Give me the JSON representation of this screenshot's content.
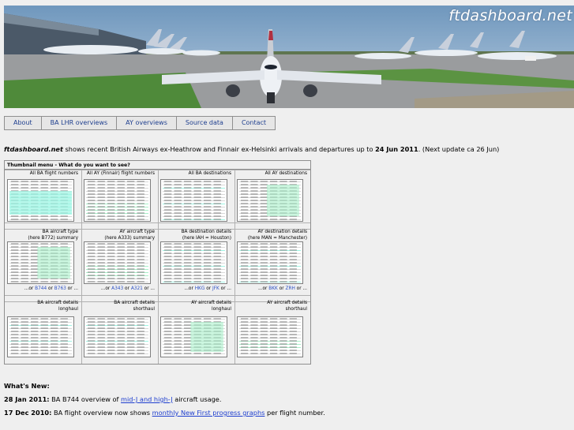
{
  "site": {
    "title": "ftdashboard.net"
  },
  "nav": {
    "items": [
      "About",
      "BA LHR overviews",
      "AY overviews",
      "Source data",
      "Contact"
    ]
  },
  "intro": {
    "brand": "ftdashboard.net",
    "text": " shows recent British Airways ex-Heathrow and Finnair ex-Helsinki arrivals and departures up to ",
    "date": "24 Jun 2011",
    "after": ". (Next update ca 26 Jun)"
  },
  "menu": {
    "header": "Thumbnail menu - What do you want to see?",
    "row1": [
      "All BA flight numbers",
      "All AY (Finnair) flight numbers",
      "All BA destinations",
      "All AY destinations"
    ],
    "row2": [
      [
        "BA aircraft type",
        "(here B772) summary"
      ],
      [
        "AY aircraft type",
        "(here A333) summary"
      ],
      [
        "BA destination details",
        "(here IAH = Houston)"
      ],
      [
        "AY destination details",
        "(here MAN = Manchester)"
      ]
    ],
    "row2_links": [
      {
        "prefix": "...or ",
        "a": "B744",
        "mid": " or ",
        "b": "B763",
        "suffix": " or ..."
      },
      {
        "prefix": "...or ",
        "a": "A343",
        "mid": " or ",
        "b": "A321",
        "suffix": " or ..."
      },
      {
        "prefix": "...or ",
        "a": "HKG",
        "mid": " or ",
        "b": "JFK",
        "suffix": " or ..."
      },
      {
        "prefix": "...or ",
        "a": "BKK",
        "mid": " or ",
        "b": "ZRH",
        "suffix": " or ..."
      }
    ],
    "row3": [
      [
        "BA aircraft details",
        "longhaul"
      ],
      [
        "BA aircraft details",
        "shorthaul"
      ],
      [
        "AY aircraft details",
        "longhaul"
      ],
      [
        "AY aircraft details",
        "shorthaul"
      ]
    ]
  },
  "whatsnew": {
    "title": "What's New:",
    "items": [
      {
        "date": "28 Jan 2011:",
        "pre": " BA B744 overview of ",
        "link1": "mid-J and high-J",
        "post": " aircraft usage."
      },
      {
        "date": "17 Dec 2010:",
        "pre": " BA flight overview now shows ",
        "link1": "monthly New First progress graphs",
        "post": " per flight number."
      }
    ]
  },
  "colors": {
    "link": "#1f3fcf",
    "thumb_highlight": "#9ff5e4",
    "sky": "#8fb1cf"
  }
}
